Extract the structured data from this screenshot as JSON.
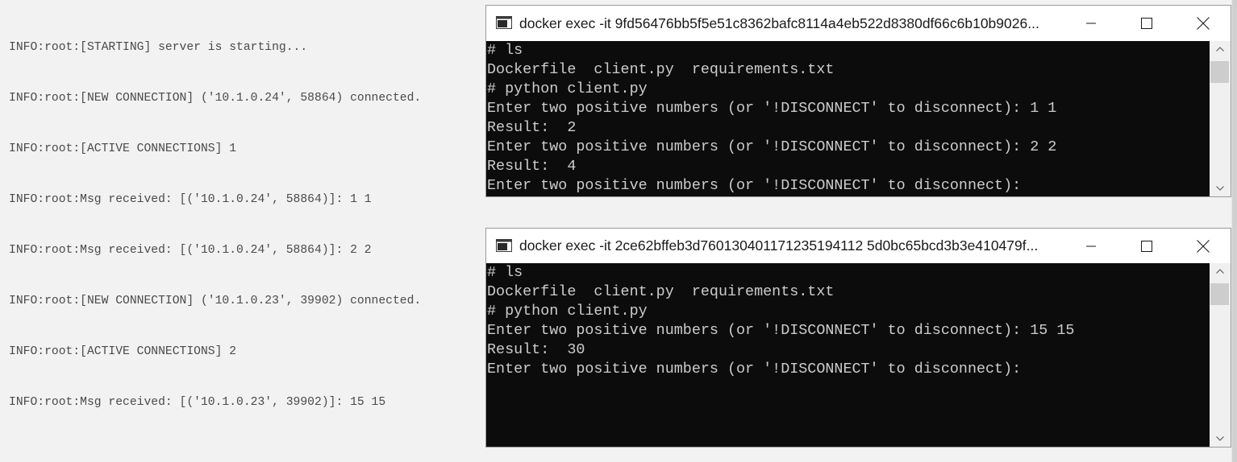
{
  "server_log": {
    "lines": [
      "INFO:root:[STARTING] server is starting...",
      "INFO:root:[NEW CONNECTION] ('10.1.0.24', 58864) connected.",
      "INFO:root:[ACTIVE CONNECTIONS] 1",
      "INFO:root:Msg received: [('10.1.0.24', 58864)]: 1 1",
      "INFO:root:Msg received: [('10.1.0.24', 58864)]: 2 2",
      "INFO:root:[NEW CONNECTION] ('10.1.0.23', 39902) connected.",
      "INFO:root:[ACTIVE CONNECTIONS] 2",
      "INFO:root:Msg received: [('10.1.0.23', 39902)]: 15 15"
    ]
  },
  "windows": [
    {
      "title": "docker  exec -it 9fd56476bb5f5e51c8362bafc8114a4eb522d8380df66c6b10b9026...",
      "icon": "console-icon",
      "lines": [
        "# ls",
        "Dockerfile  client.py  requirements.txt",
        "# python client.py",
        "Enter two positive numbers (or '!DISCONNECT' to disconnect): 1 1",
        "Result:  2",
        "Enter two positive numbers (or '!DISCONNECT' to disconnect): 2 2",
        "Result:  4",
        "Enter two positive numbers (or '!DISCONNECT' to disconnect):"
      ]
    },
    {
      "title": "docker  exec -it 2ce62bffeb3d760130401171235194112 5d0bc65bcd3b3e410479f...",
      "icon": "console-icon",
      "lines": [
        "# ls",
        "Dockerfile  client.py  requirements.txt",
        "# python client.py",
        "Enter two positive numbers (or '!DISCONNECT' to disconnect): 15 15",
        "Result:  30",
        "Enter two positive numbers (or '!DISCONNECT' to disconnect):"
      ]
    }
  ],
  "colors": {
    "desktop_bg": "#f2f2f2",
    "console_bg": "#0c0c0c",
    "console_text": "#cccccc",
    "titlebar_bg": "#ffffff"
  }
}
